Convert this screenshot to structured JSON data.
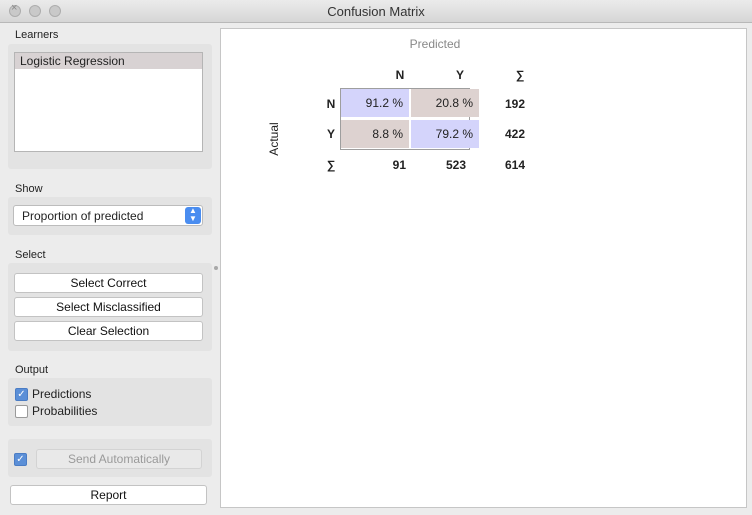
{
  "window": {
    "title": "Confusion Matrix"
  },
  "learners": {
    "label": "Learners",
    "items": [
      "Logistic Regression"
    ]
  },
  "show": {
    "label": "Show",
    "selected": "Proportion of predicted"
  },
  "select": {
    "label": "Select",
    "buttons": {
      "correct": "Select Correct",
      "misclassified": "Select Misclassified",
      "clear": "Clear Selection"
    }
  },
  "output": {
    "label": "Output",
    "predictions": {
      "label": "Predictions",
      "checked": true
    },
    "probabilities": {
      "label": "Probabilities",
      "checked": false
    }
  },
  "send": {
    "label": "Send Automatically",
    "checked": true
  },
  "report": {
    "label": "Report"
  },
  "matrix": {
    "predicted_label": "Predicted",
    "actual_label": "Actual",
    "col_headers": [
      "N",
      "Y",
      "∑"
    ],
    "row_headers": [
      "N",
      "Y",
      "∑"
    ],
    "cells": [
      [
        "91.2 %",
        "20.8 %"
      ],
      [
        "8.8 %",
        "79.2 %"
      ]
    ],
    "row_sums": [
      "192",
      "422"
    ],
    "col_sums": [
      "91",
      "523"
    ],
    "total": "614",
    "colors": {
      "correct": "#d4d4fb",
      "incorrect": "#ddd2d0"
    }
  }
}
